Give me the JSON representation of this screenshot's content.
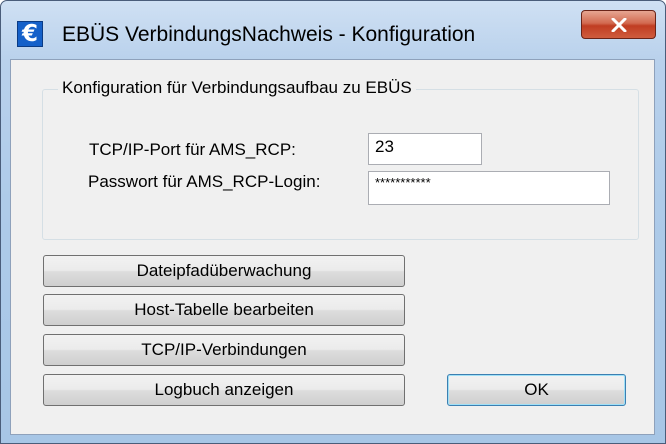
{
  "window": {
    "title": "EBÜS VerbindungsNachweis - Konfiguration",
    "icon": "euro-icon",
    "icon_glyph": "€",
    "close_icon": "close-icon"
  },
  "group": {
    "legend": "Konfiguration für Verbindungsaufbau zu EBÜS",
    "port_label": "TCP/IP-Port für AMS_RCP:",
    "port_value": "23",
    "password_label": "Passwort für AMS_RCP-Login:",
    "password_value": "***********"
  },
  "buttons": {
    "file_watch": "Dateipfadüberwachung",
    "host_table": "Host-Tabelle bearbeiten",
    "tcp_connections": "TCP/IP-Verbindungen",
    "log": "Logbuch anzeigen",
    "ok": "OK"
  },
  "colors": {
    "title_bar": "#b9d1ec",
    "close_button": "#c7432b",
    "dialog_background": "#f0f0f0",
    "default_button_border": "#3c7fb1"
  }
}
